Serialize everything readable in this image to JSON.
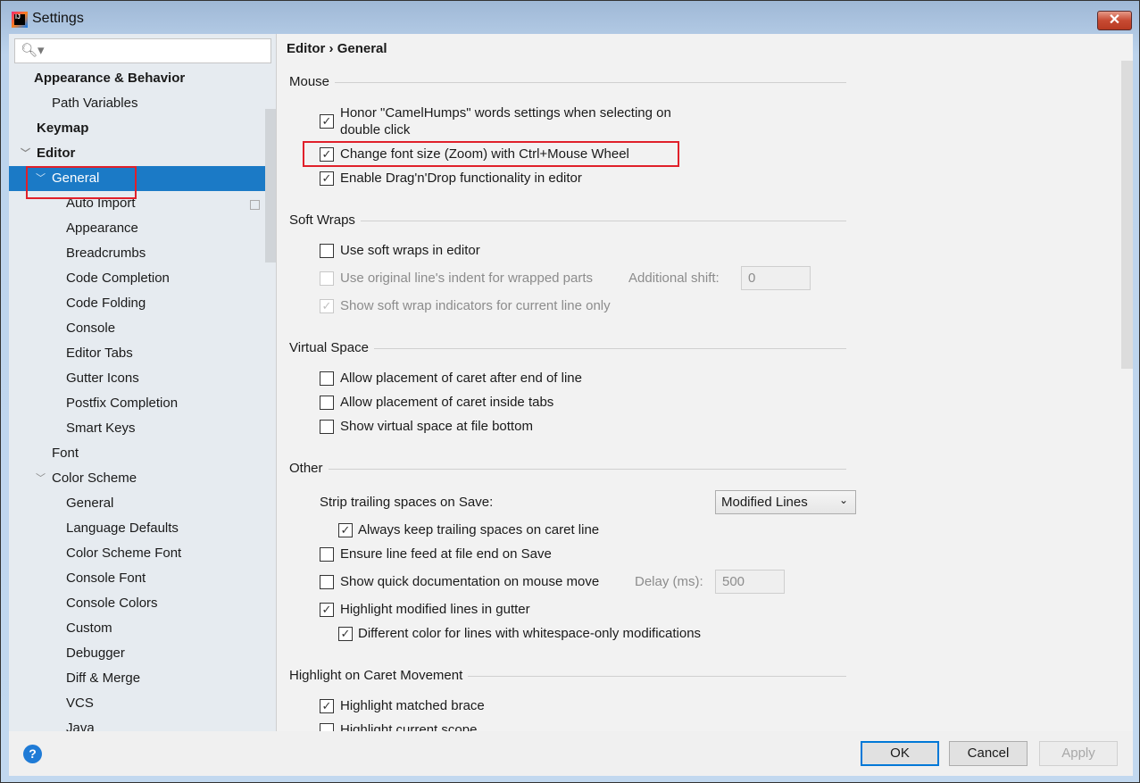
{
  "window": {
    "title": "Settings",
    "close": "✕"
  },
  "search": {
    "placeholder": "",
    "icon": "search-icon"
  },
  "tree": [
    {
      "label": "Appearance & Behavior",
      "bold": true
    },
    {
      "label": "Path Variables"
    },
    {
      "label": "Keymap",
      "bold": true
    },
    {
      "label": "Editor",
      "bold": true,
      "expanded": true
    },
    {
      "label": "General",
      "expanded": true,
      "selected": true
    },
    {
      "label": "Auto Import"
    },
    {
      "label": "Appearance"
    },
    {
      "label": "Breadcrumbs"
    },
    {
      "label": "Code Completion"
    },
    {
      "label": "Code Folding"
    },
    {
      "label": "Console"
    },
    {
      "label": "Editor Tabs"
    },
    {
      "label": "Gutter Icons"
    },
    {
      "label": "Postfix Completion"
    },
    {
      "label": "Smart Keys"
    },
    {
      "label": "Font"
    },
    {
      "label": "Color Scheme",
      "expanded": true
    },
    {
      "label": "General"
    },
    {
      "label": "Language Defaults"
    },
    {
      "label": "Color Scheme Font"
    },
    {
      "label": "Console Font"
    },
    {
      "label": "Console Colors"
    },
    {
      "label": "Custom"
    },
    {
      "label": "Debugger"
    },
    {
      "label": "Diff & Merge"
    },
    {
      "label": "VCS"
    },
    {
      "label": "Java"
    }
  ],
  "breadcrumb": {
    "parent": "Editor",
    "sep": "›",
    "current": "General"
  },
  "sections": {
    "mouse": "Mouse",
    "soft_wraps": "Soft Wraps",
    "virtual_space": "Virtual Space",
    "other": "Other",
    "caret": "Highlight on Caret Movement"
  },
  "options": {
    "camel": {
      "label": "Honor \"CamelHumps\" words settings when selecting on",
      "label2": "double click",
      "checked": true
    },
    "zoom": {
      "label": "Change font size (Zoom) with Ctrl+Mouse Wheel",
      "checked": true
    },
    "dnd": {
      "label": "Enable Drag'n'Drop functionality in editor",
      "checked": true
    },
    "soft_wraps": {
      "label": "Use soft wraps in editor",
      "checked": false
    },
    "orig_indent": {
      "label": "Use original line's indent for wrapped parts",
      "checked": false,
      "disabled": true
    },
    "additional_shift": {
      "label": "Additional shift:",
      "value": "0"
    },
    "wrap_ind": {
      "label": "Show soft wrap indicators for current line only",
      "checked": true,
      "disabled": true
    },
    "caret_after_end": {
      "label": "Allow placement of caret after end of line",
      "checked": false
    },
    "caret_tabs": {
      "label": "Allow placement of caret inside tabs",
      "checked": false
    },
    "virtual_bottom": {
      "label": "Show virtual space at file bottom",
      "checked": false
    },
    "strip": {
      "label": "Strip trailing spaces on Save:",
      "value": "Modified Lines"
    },
    "keep_trailing": {
      "label": "Always keep trailing spaces on caret line",
      "checked": true
    },
    "line_feed": {
      "label": "Ensure line feed at file end on Save",
      "checked": false
    },
    "quick_doc": {
      "label": "Show quick documentation on mouse move",
      "checked": false
    },
    "delay": {
      "label": "Delay (ms):",
      "value": "500"
    },
    "hl_modified": {
      "label": "Highlight modified lines in gutter",
      "checked": true
    },
    "diff_ws": {
      "label": "Different color for lines with whitespace-only modifications",
      "checked": true
    },
    "matched_brace": {
      "label": "Highlight matched brace",
      "checked": true
    },
    "current_scope": {
      "label": "Highlight current scope",
      "checked": false
    }
  },
  "footer": {
    "help": "?",
    "ok": "OK",
    "cancel": "Cancel",
    "apply": "Apply"
  }
}
